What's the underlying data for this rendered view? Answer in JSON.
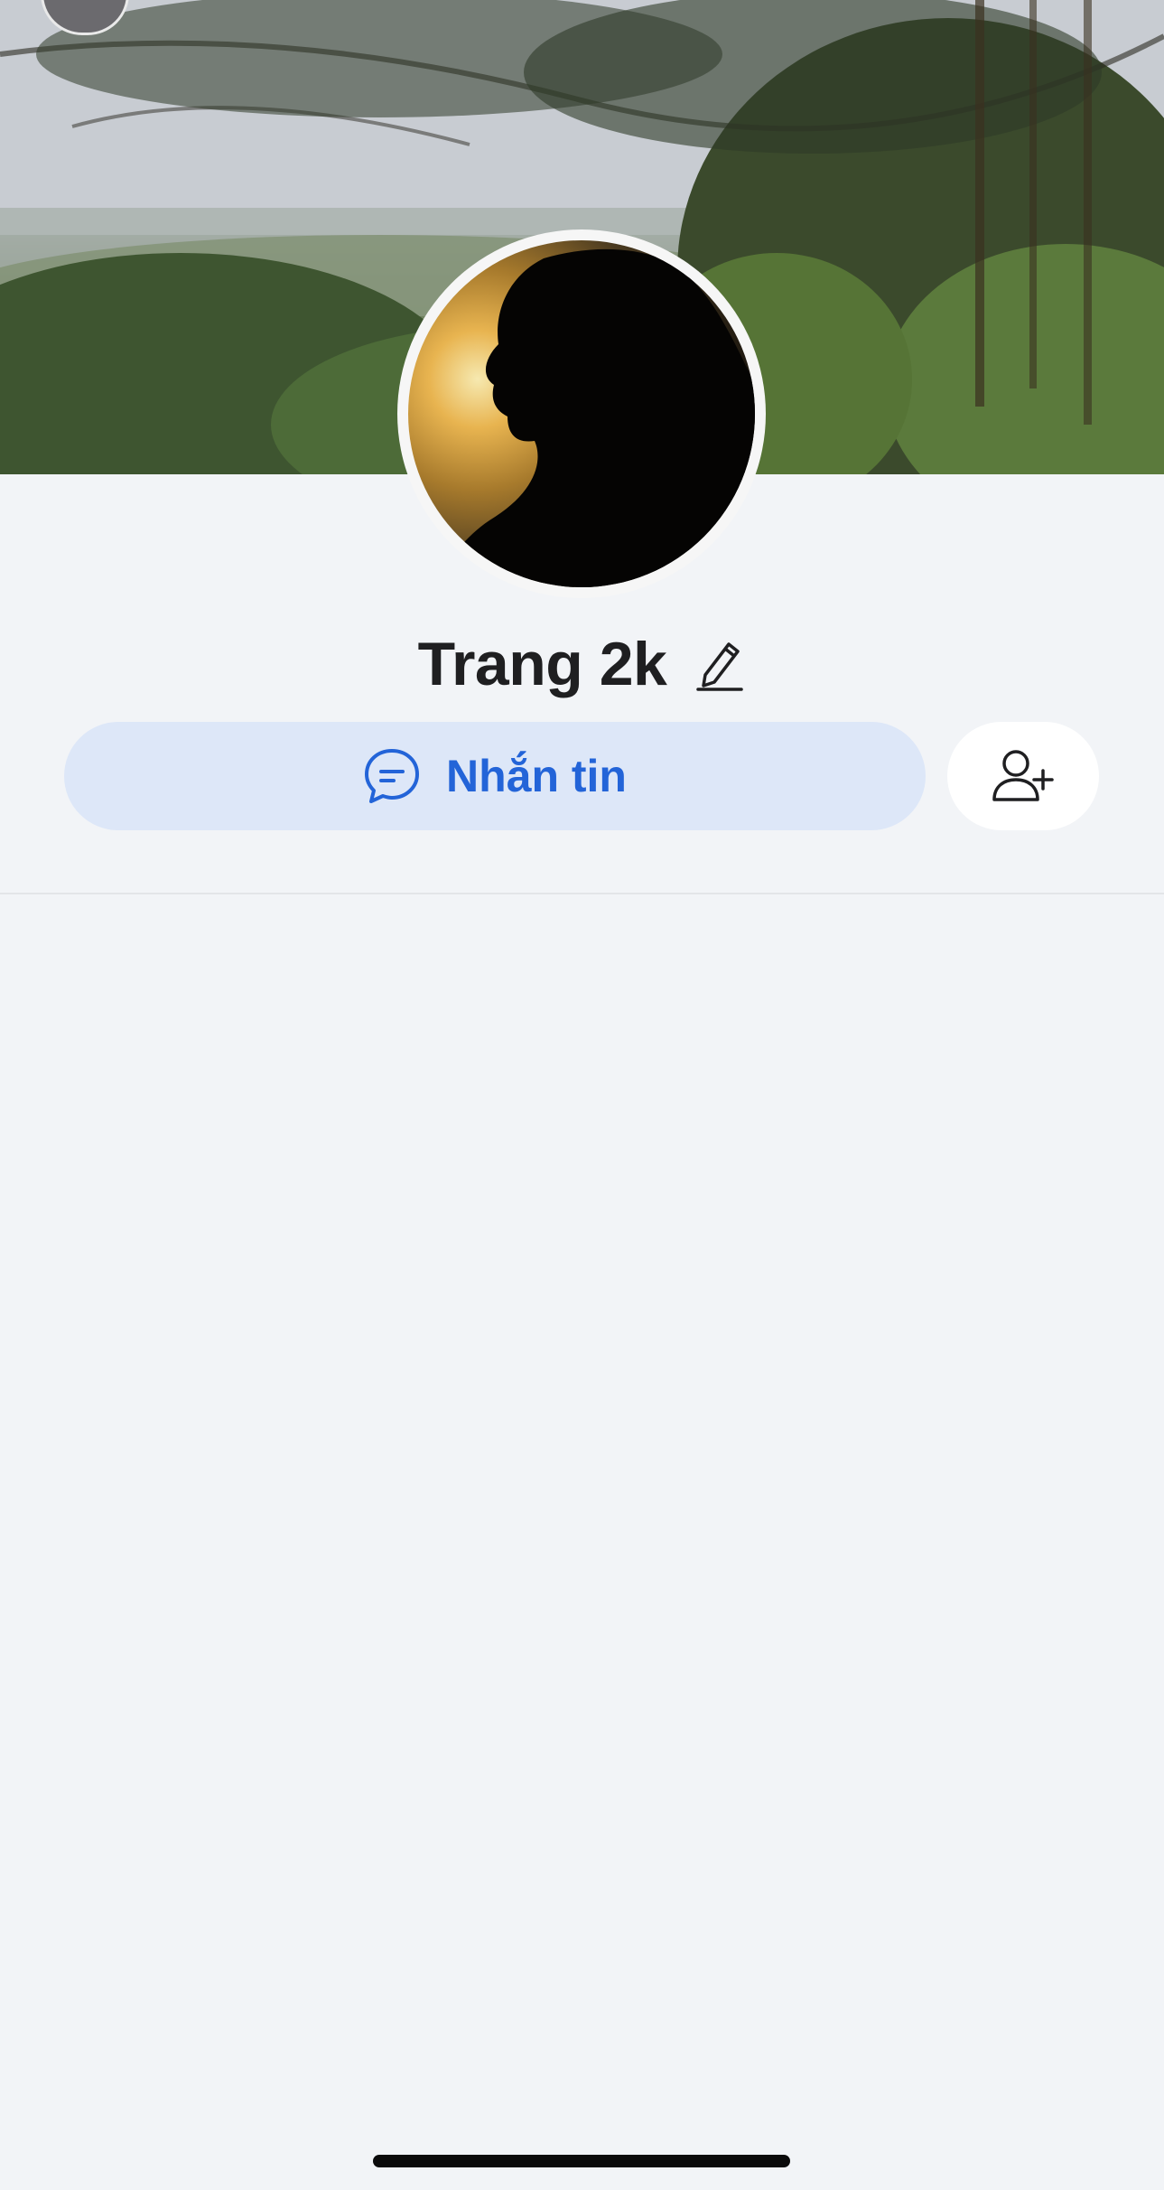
{
  "profile": {
    "name": "Trang 2k",
    "message_button_label": "Nhắn tin"
  },
  "icons": {
    "edit": "pencil-icon",
    "message": "chat-bubble-icon",
    "add_friend": "add-friend-icon"
  },
  "colors": {
    "accent": "#2364d8",
    "accent_bg": "#dde7f8",
    "page_bg": "#f2f4f7"
  }
}
